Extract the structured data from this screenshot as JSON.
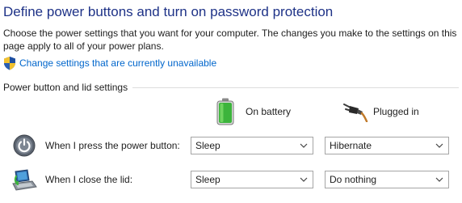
{
  "header": {
    "title": "Define power buttons and turn on password protection",
    "description": "Choose the power settings that you want for your computer. The changes you make to the settings on this page apply to all of your power plans."
  },
  "admin_link": {
    "icon": "uac-shield-icon",
    "label": "Change settings that are currently unavailable"
  },
  "section": {
    "title": "Power button and lid settings"
  },
  "columns": {
    "battery": {
      "label": "On battery",
      "icon": "battery-icon"
    },
    "plugged": {
      "label": "Plugged in",
      "icon": "power-plug-icon"
    }
  },
  "rows": [
    {
      "label": "When I press the power button:",
      "icon": "power-button-icon",
      "battery_value": "Sleep",
      "plugged_value": "Hibernate"
    },
    {
      "label": "When I close the lid:",
      "icon": "laptop-lid-icon",
      "battery_value": "Sleep",
      "plugged_value": "Do nothing"
    }
  ],
  "colors": {
    "title": "#1e3287",
    "link": "#0066cc",
    "text": "#1e1e1e",
    "divider": "#dcdcdc",
    "select_border": "#a5a5a5",
    "battery_green": "#3cb43c"
  }
}
